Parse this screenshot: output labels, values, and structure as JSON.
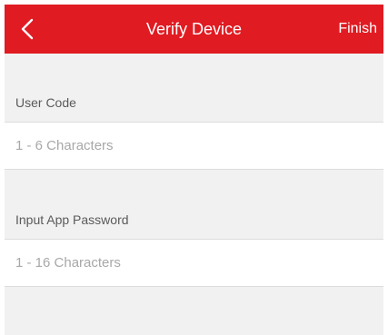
{
  "header": {
    "title": "Verify Device",
    "back_icon": "chevron-left-icon",
    "finish_label": "Finish",
    "background_color": "#e11b22"
  },
  "form": {
    "user_code": {
      "label": "User Code",
      "value": "",
      "placeholder": "1 - 6 Characters"
    },
    "app_password": {
      "label": "Input App Password",
      "value": "",
      "placeholder": "1 - 16 Characters"
    }
  }
}
